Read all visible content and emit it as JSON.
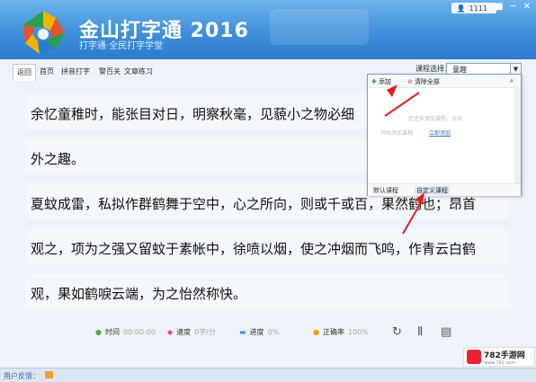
{
  "app": {
    "title": "金山打字通 2016",
    "subtitle": "打字通·全民打字学堂",
    "user_label": "1111"
  },
  "window_controls": [
    "■",
    "─",
    "✕"
  ],
  "nav": {
    "tabs": [
      "返回",
      "首页",
      "拼音打字",
      "警百关",
      "文章练习"
    ]
  },
  "course": {
    "label": "课程选择：",
    "value": "童趣"
  },
  "article": {
    "lines": [
      "余忆童稚时，能张目对日，明察秋毫，见藐小之物必细",
      "外之趣。",
      "夏蚊成雷，私拟作群鹤舞于空中，心之所向，则或千或百，果然鹤也；昂首",
      "观之，项为之强又留蚊于素帐中，徐喷以烟，使之冲烟而飞鸣，作青云白鹤",
      "观，果如鹤唳云端，为之怡然称快。"
    ]
  },
  "stats": [
    {
      "label": "时间",
      "value": "00:00:00",
      "icon": "clock-icon",
      "color": "#4caf50"
    },
    {
      "label": "速度",
      "value": "0字/分",
      "icon": "speed-icon",
      "color": "#e040a0"
    },
    {
      "label": "进度",
      "value": "0%",
      "icon": "progress-icon",
      "color": "#2196f3"
    },
    {
      "label": "正确率",
      "value": "100%",
      "icon": "accuracy-icon",
      "color": "#ff9800"
    }
  ],
  "controls": {
    "restart": "↻",
    "pause": "Ⅱ",
    "settings": "▤"
  },
  "popup": {
    "add_label": "添加",
    "clear_label": "清除全部",
    "empty_line1": "您还未添加课程，点击",
    "empty_line2": "开始添加课程",
    "empty_link": "立即添加",
    "tab_default": "默认课程",
    "tab_custom": "自定义课程"
  },
  "footer": {
    "text": "用户反馈："
  },
  "watermark": {
    "text": "782手游网",
    "sub": "www.782.com"
  }
}
